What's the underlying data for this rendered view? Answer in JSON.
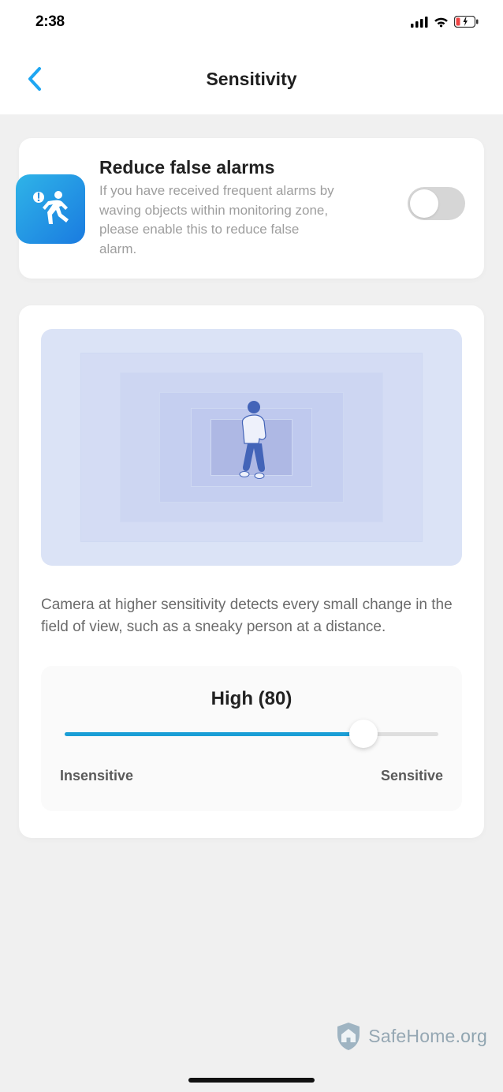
{
  "status": {
    "time": "2:38"
  },
  "nav": {
    "title": "Sensitivity"
  },
  "reduce": {
    "title": "Reduce false alarms",
    "text": "If you have received frequent alarms by waving objects within monitoring zone, please enable this to reduce false alarm.",
    "enabled": false
  },
  "sensitivity": {
    "description": "Camera at higher sensitivity detects every small change in the field of view, such as a sneaky person at a distance.",
    "level_label": "High (80)",
    "value": 80,
    "left_label": "Insensitive",
    "right_label": "Sensitive"
  },
  "watermark": {
    "brand": "SafeHome",
    "suffix": ".org"
  },
  "colors": {
    "accent": "#1a9ed6",
    "icon_gradient_from": "#2fb4e8",
    "icon_gradient_to": "#1a7be0"
  }
}
